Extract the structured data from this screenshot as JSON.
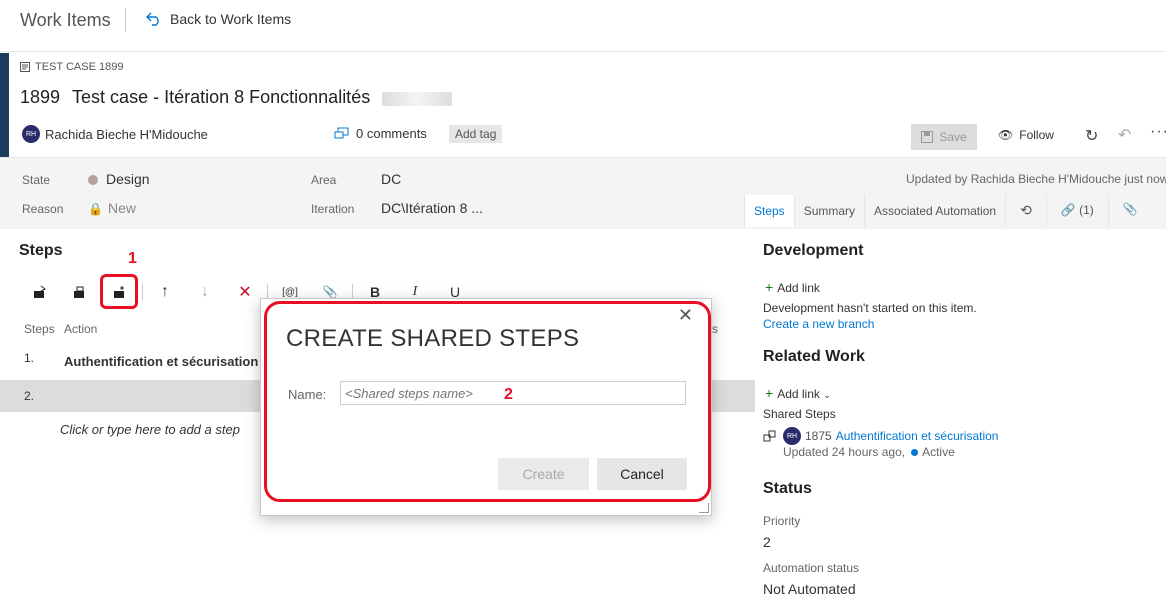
{
  "topbar": {
    "title": "Work Items",
    "back_label": "Back to Work Items"
  },
  "header": {
    "type_label": "TEST CASE 1899",
    "id": "1899",
    "title": "Test case - Itération 8 Fonctionnalités",
    "user_initials": "RH",
    "user_name": "Rachida Bieche H'Midouche",
    "comments": "0 comments",
    "add_tag": "Add tag",
    "save": "Save",
    "follow": "Follow",
    "icons": [
      "refresh-icon",
      "undo-icon",
      "more-icon"
    ]
  },
  "fields": {
    "state_label": "State",
    "state_value": "Design",
    "reason_label": "Reason",
    "reason_value": "New",
    "area_label": "Area",
    "area_value": "DC",
    "iteration_label": "Iteration",
    "iteration_value": "DC\\Itération 8 ...",
    "updated": "Updated by Rachida Bieche H'Midouche just now"
  },
  "tabs": [
    "Steps",
    "Summary",
    "Associated Automation",
    "",
    "(1)",
    ""
  ],
  "steps": {
    "title": "Steps",
    "annotation_1": "1",
    "col_steps": "Steps",
    "col_action": "Action",
    "col_expected_fragment": "s",
    "rows": [
      {
        "num": "1.",
        "action": "Authentification et sécurisation"
      },
      {
        "num": "2.",
        "action": ""
      }
    ],
    "add_step": "Click or type here to add a step",
    "toolbar": {
      "mention": "[@]",
      "bold": "B",
      "italic": "I",
      "underline": "U"
    }
  },
  "right_panel": {
    "development_title": "Development",
    "add_link": "Add link",
    "dev_status": "Development hasn't started on this item.",
    "create_branch": "Create a new branch",
    "related_title": "Related Work",
    "add_link_dropdown": "Add link",
    "shared_steps_label": "Shared Steps",
    "linked_id": "1875",
    "linked_title": "Authentification et sécurisation",
    "linked_initials": "RH",
    "linked_updated": "Updated 24 hours ago,",
    "linked_state": "Active",
    "status_title": "Status",
    "priority_label": "Priority",
    "priority_value": "2",
    "automation_label": "Automation status",
    "automation_value": "Not Automated"
  },
  "modal": {
    "title": "CREATE SHARED STEPS",
    "name_label": "Name:",
    "name_placeholder": "<Shared steps name>",
    "create": "Create",
    "cancel": "Cancel",
    "annotation_2": "2"
  },
  "colors": {
    "accent": "#0078d4",
    "annotation_red": "#e81123",
    "header_bar": "#1c3c5d"
  }
}
